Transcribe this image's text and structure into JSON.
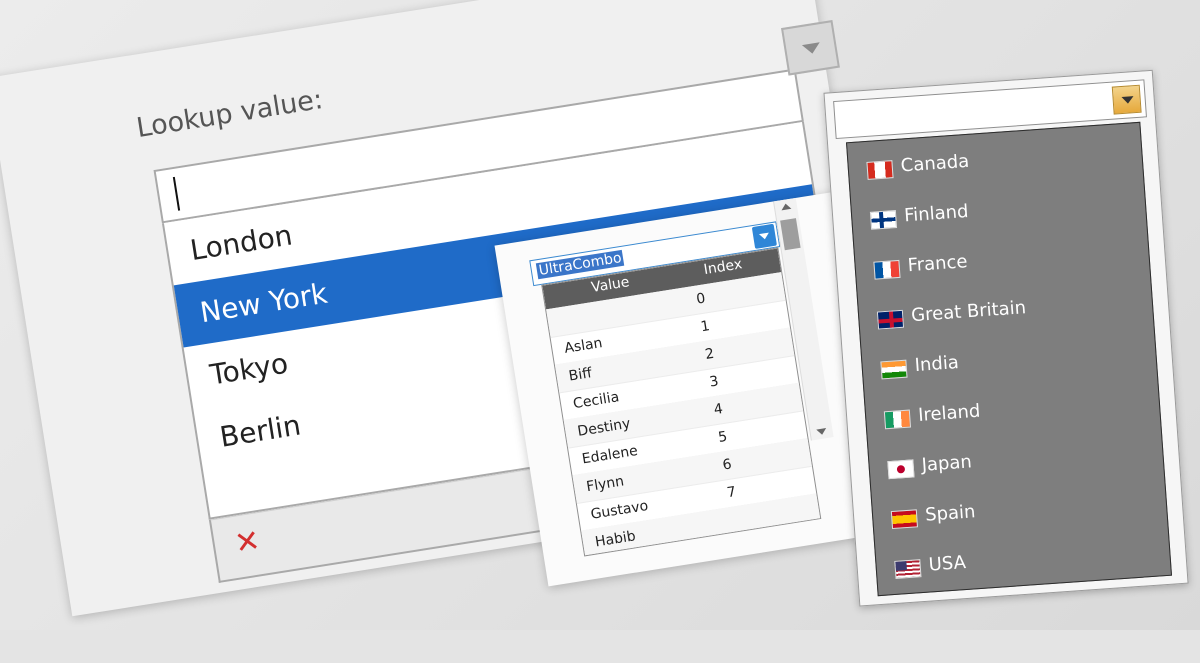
{
  "lookup": {
    "label": "Lookup value:",
    "input_value": "",
    "items": [
      "London",
      "New York",
      "Tokyo",
      "Berlin"
    ],
    "selected": "New York",
    "close_symbol": "✕"
  },
  "ultracombo": {
    "input_value": "UltraCombo",
    "headers": [
      "Value",
      "Index"
    ],
    "rows": [
      [
        "",
        "0"
      ],
      [
        "Aslan",
        "1"
      ],
      [
        "Biff",
        "2"
      ],
      [
        "Cecilia",
        "3"
      ],
      [
        "Destiny",
        "4"
      ],
      [
        "Edalene",
        "5"
      ],
      [
        "Flynn",
        "6"
      ],
      [
        "Gustavo",
        "7"
      ],
      [
        "Habib",
        ""
      ]
    ]
  },
  "countries": {
    "items": [
      "Canada",
      "Finland",
      "France",
      "Great Britain",
      "India",
      "Ireland",
      "Japan",
      "Spain",
      "USA"
    ],
    "icons": [
      "canada-flag-icon",
      "finland-flag-icon",
      "france-flag-icon",
      "great-britain-flag-icon",
      "india-flag-icon",
      "ireland-flag-icon",
      "japan-flag-icon",
      "spain-flag-icon",
      "usa-flag-icon"
    ]
  },
  "colors": {
    "selection": "#1f6bc8",
    "combo_accent": "#2f86d7",
    "close": "#d32f2f"
  }
}
